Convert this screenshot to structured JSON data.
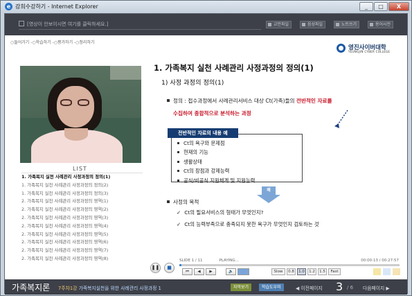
{
  "window": {
    "title": "강희수강하기 - Internet Explorer",
    "buttons": [
      "_",
      "□",
      "X"
    ]
  },
  "topbar": {
    "notice": "[영상이 안보이시면 여기를 클릭하세요.]",
    "buttons": [
      "교안파일",
      "음성파일",
      "노트쓰기",
      "용어사전"
    ]
  },
  "steps": "○들어가기 -○학습하기 -○평가하기 -○정리하기",
  "logo": {
    "korean": "영진사이버대학",
    "english": "YEUNGJIN CYBER COLLEGE"
  },
  "list": {
    "title": "LIST",
    "items": [
      "1. 가족복지 실천 사례관리 사정과정의 정의(1)",
      "1. 가족복지 실천 사례관리 사정과정의 정의(2)",
      "1. 가족복지 실천 사례관리 사정과정의 정의(3)",
      "2. 가족복지 실천 사례관리 사정과정의 영역(1)",
      "2. 가족복지 실천 사례관리 사정과정의 영역(2)",
      "2. 가족복지 실천 사례관리 사정과정의 영역(3)",
      "2. 가족복지 실천 사례관리 사정과정의 영역(4)",
      "2. 가족복지 실천 사례관리 사정과정의 영역(5)",
      "2. 가족복지 실천 사례관리 사정과정의 영역(6)",
      "2. 가족복지 실천 사례관리 사정과정의 영역(7)",
      "2. 가족복지 실천 사례관리 사정과정의 영역(8)"
    ]
  },
  "slide": {
    "heading": "1. 가족복지 실천 사례관리 사정과정의 정의(1)",
    "subheading": "1) 사정 과정의 정의(1)",
    "definition_prefix": "정의 : 접수과정에서 사례관리서비스 대상 Ct(가족)들의 ",
    "definition_red1": "전반적인 자료를",
    "definition_red2": "수집하여 종합적으로 분석하는 과정",
    "callout": "전반적인 자료의 내용 예",
    "box_items": [
      "Ct의 욕구와 문제점",
      "현재의 기능",
      "생활상태",
      "Ct의 장점과 강제능력",
      "공식/비공식 지원체계 및 지원능력"
    ],
    "arrow_label": "왜",
    "purpose_label": "사정의 목적",
    "checks": [
      "Ct의 필요서비스의 형태가 무엇인지?",
      "Ct의 능력부족으로 충족되지 못한 욕구가 무엇인지 검토하는 것"
    ]
  },
  "player": {
    "slide": "SLIDE  1  /  11",
    "status": "PLAYING...",
    "time": "00:00:13 / 00:27:57",
    "progress": 0.008,
    "speeds": [
      "Slow",
      "0.8",
      "1.0",
      "1.2",
      "1.5",
      "Fast"
    ],
    "current_speed": "1.0"
  },
  "footer": {
    "course": "가족복지론",
    "week": "7주차1강",
    "lecture": "가족복지실천을 위한 사례관리 사정과정 1",
    "caption": "자막보기",
    "help": "학습도우미",
    "prev": "◀ 이전페이지",
    "page": "3",
    "total": "/ 6",
    "next": "다음페이지 ▶"
  }
}
